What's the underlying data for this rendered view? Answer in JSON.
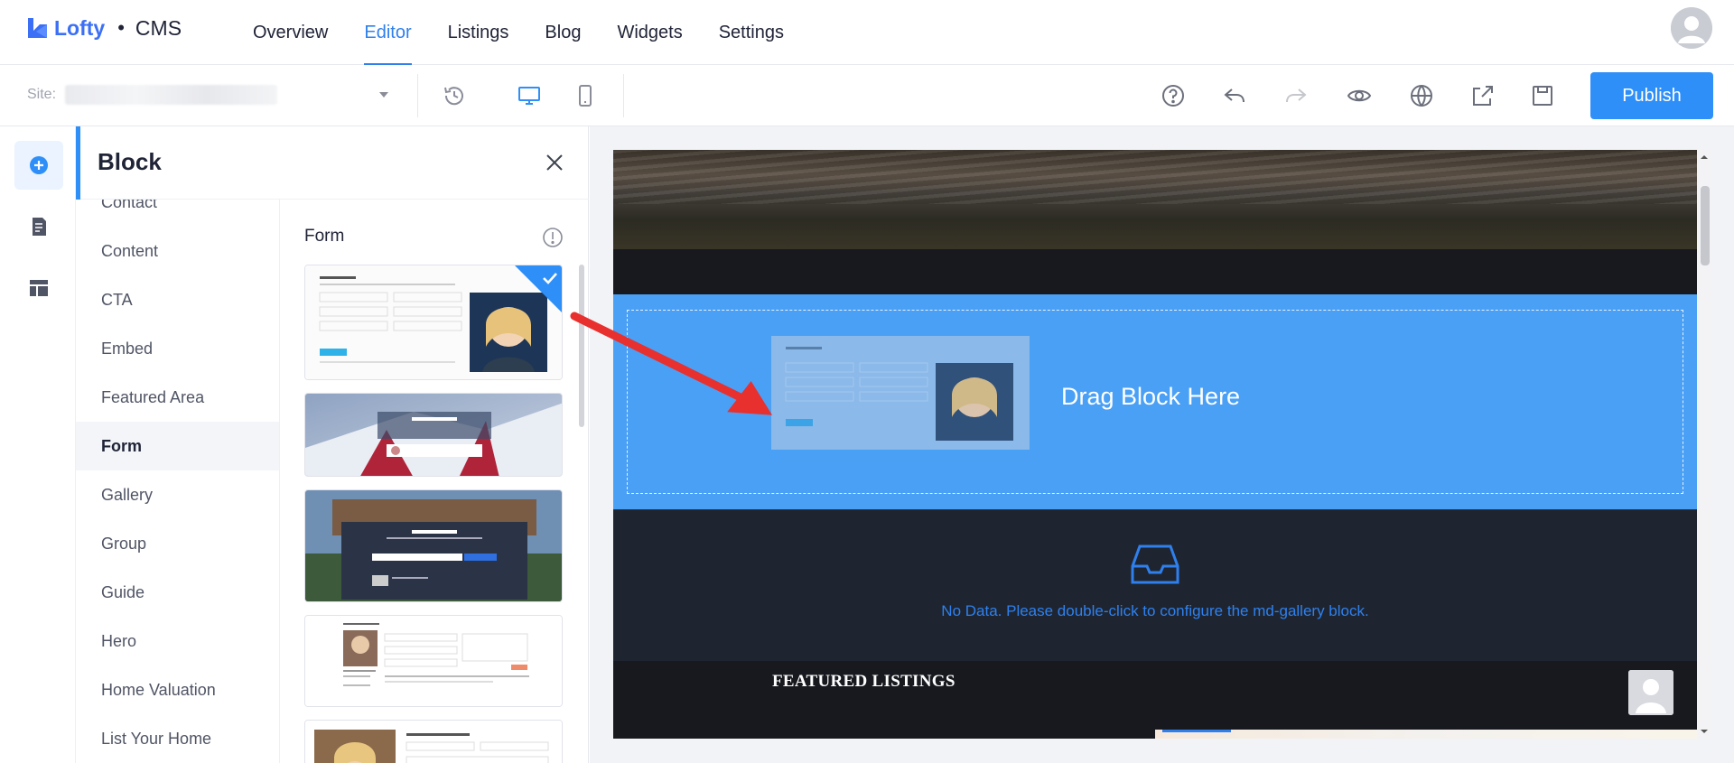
{
  "brand": {
    "name": "Lofty",
    "separator": "•",
    "product": "CMS",
    "color": "#3b6ff5"
  },
  "nav": {
    "tabs": [
      {
        "label": "Overview"
      },
      {
        "label": "Editor"
      },
      {
        "label": "Listings"
      },
      {
        "label": "Blog"
      },
      {
        "label": "Widgets"
      },
      {
        "label": "Settings"
      }
    ],
    "active_tab": "Editor"
  },
  "toolbar": {
    "site_label": "Site:",
    "icons": [
      "history-icon",
      "desktop-icon",
      "mobile-icon",
      "help-icon",
      "undo-icon",
      "redo-icon",
      "preview-eye-icon",
      "globe-icon",
      "export-icon",
      "save-icon"
    ],
    "publish_label": "Publish",
    "accent": "#2f8ff8"
  },
  "rail": {
    "icons": [
      "add-block-icon",
      "page-icon",
      "layout-icon"
    ]
  },
  "panel": {
    "title": "Block",
    "categories": [
      {
        "label": "Contact"
      },
      {
        "label": "Content"
      },
      {
        "label": "CTA"
      },
      {
        "label": "Embed"
      },
      {
        "label": "Featured Area"
      },
      {
        "label": "Form"
      },
      {
        "label": "Gallery"
      },
      {
        "label": "Group"
      },
      {
        "label": "Guide"
      },
      {
        "label": "Hero"
      },
      {
        "label": "Home Valuation"
      },
      {
        "label": "List Your Home"
      }
    ],
    "active_category": "Form",
    "section_title": "Form",
    "templates": [
      {
        "name": "form-template-sell-my-home-1",
        "heading": "Sell My Home",
        "selected": true
      },
      {
        "name": "form-template-sell-my-home-2",
        "heading": "Sell My Home",
        "selected": false
      },
      {
        "name": "form-template-sell-my-home-3",
        "heading": "Sell My Home",
        "selected": false
      },
      {
        "name": "form-template-get-more-info-1",
        "heading": "GET MORE INFORMATION",
        "selected": false
      },
      {
        "name": "form-template-get-more-info-2",
        "heading": "GET MORE INFORMATION",
        "selected": false
      }
    ]
  },
  "canvas": {
    "drop_text": "Drag Block Here",
    "gallery_message": "No Data. Please double-click to configure the md-gallery block.",
    "featured_title": "FEATURED LISTINGS",
    "drop_color": "#4aa0f5"
  }
}
